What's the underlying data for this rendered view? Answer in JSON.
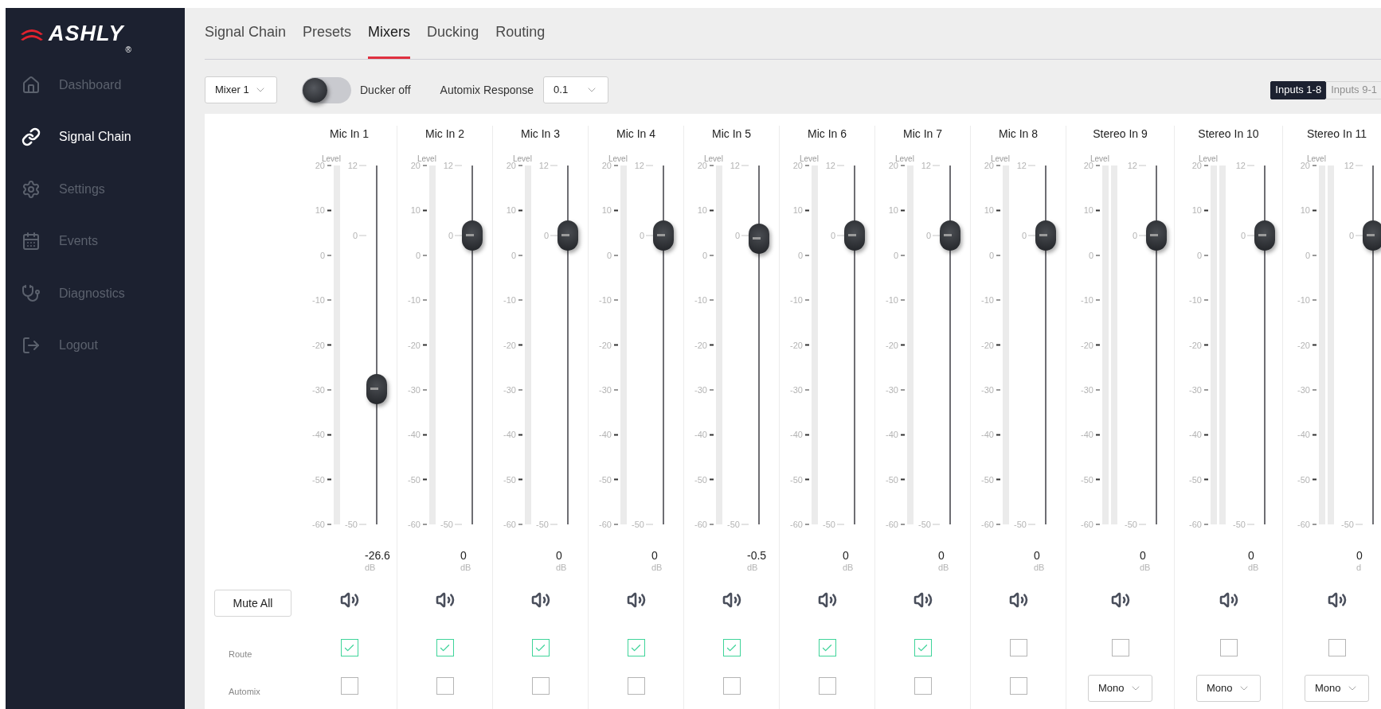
{
  "logo": {
    "text": "ASHLY",
    "mark": "®"
  },
  "sidebar": {
    "items": [
      {
        "label": "Dashboard",
        "selected": false
      },
      {
        "label": "Signal Chain",
        "selected": true
      },
      {
        "label": "Settings",
        "selected": false
      },
      {
        "label": "Events",
        "selected": false
      },
      {
        "label": "Diagnostics",
        "selected": false
      },
      {
        "label": "Logout",
        "selected": false
      }
    ]
  },
  "tabs": [
    {
      "label": "Signal Chain",
      "selected": false
    },
    {
      "label": "Presets",
      "selected": false
    },
    {
      "label": "Mixers",
      "selected": true
    },
    {
      "label": "Ducking",
      "selected": false
    },
    {
      "label": "Routing",
      "selected": false
    }
  ],
  "toolbar": {
    "mixer": "Mixer 1",
    "ducker": {
      "on": false,
      "label": "Ducker off"
    },
    "automix_label": "Automix Response",
    "automix_value": "0.1",
    "inputs": [
      {
        "label": "Inputs 1-8",
        "selected": true
      },
      {
        "label": "Inputs 9-1",
        "selected": false
      }
    ]
  },
  "panel": {
    "mute_all": "Mute All",
    "route_label": "Route",
    "automix_label": "Automix",
    "channels": [
      {
        "name": "Mic In 1",
        "kind": "mic",
        "meter_label": "Level",
        "meter_ticks": [
          "20",
          "10",
          "0",
          "-10",
          "-20",
          "-30",
          "-40",
          "-50",
          "-60"
        ],
        "fader_ticks": [
          "12",
          "0",
          "-50"
        ],
        "level": 0.377,
        "value": "-26.6",
        "unit": "dB",
        "muted": false,
        "route": true,
        "automix": false
      },
      {
        "name": "Mic In 2",
        "kind": "mic",
        "meter_label": "Level",
        "meter_ticks": [
          "20",
          "10",
          "0",
          "-10",
          "-20",
          "-30",
          "-40",
          "-50",
          "-60"
        ],
        "fader_ticks": [
          "12",
          "0",
          "-50"
        ],
        "level": 0.805,
        "value": "0",
        "unit": "dB",
        "muted": false,
        "route": true,
        "automix": false
      },
      {
        "name": "Mic In 3",
        "kind": "mic",
        "meter_label": "Level",
        "meter_ticks": [
          "20",
          "10",
          "0",
          "-10",
          "-20",
          "-30",
          "-40",
          "-50",
          "-60"
        ],
        "fader_ticks": [
          "12",
          "0",
          "-50"
        ],
        "level": 0.805,
        "value": "0",
        "unit": "dB",
        "muted": false,
        "route": true,
        "automix": false
      },
      {
        "name": "Mic In 4",
        "kind": "mic",
        "meter_label": "Level",
        "meter_ticks": [
          "20",
          "10",
          "0",
          "-10",
          "-20",
          "-30",
          "-40",
          "-50",
          "-60"
        ],
        "fader_ticks": [
          "12",
          "0",
          "-50"
        ],
        "level": 0.805,
        "value": "0",
        "unit": "dB",
        "muted": false,
        "route": true,
        "automix": false
      },
      {
        "name": "Mic In 5",
        "kind": "mic",
        "meter_label": "Level",
        "meter_ticks": [
          "20",
          "10",
          "0",
          "-10",
          "-20",
          "-30",
          "-40",
          "-50",
          "-60"
        ],
        "fader_ticks": [
          "12",
          "0",
          "-50"
        ],
        "level": 0.797,
        "value": "-0.5",
        "unit": "dB",
        "muted": false,
        "route": true,
        "automix": false
      },
      {
        "name": "Mic In 6",
        "kind": "mic",
        "meter_label": "Level",
        "meter_ticks": [
          "20",
          "10",
          "0",
          "-10",
          "-20",
          "-30",
          "-40",
          "-50",
          "-60"
        ],
        "fader_ticks": [
          "12",
          "0",
          "-50"
        ],
        "level": 0.805,
        "value": "0",
        "unit": "dB",
        "muted": false,
        "route": true,
        "automix": false
      },
      {
        "name": "Mic In 7",
        "kind": "mic",
        "meter_label": "Level",
        "meter_ticks": [
          "20",
          "10",
          "0",
          "-10",
          "-20",
          "-30",
          "-40",
          "-50",
          "-60"
        ],
        "fader_ticks": [
          "12",
          "0",
          "-50"
        ],
        "level": 0.805,
        "value": "0",
        "unit": "dB",
        "muted": false,
        "route": true,
        "automix": false
      },
      {
        "name": "Mic In 8",
        "kind": "mic",
        "meter_label": "Level",
        "meter_ticks": [
          "20",
          "10",
          "0",
          "-10",
          "-20",
          "-30",
          "-40",
          "-50",
          "-60"
        ],
        "fader_ticks": [
          "12",
          "0",
          "-50"
        ],
        "level": 0.805,
        "value": "0",
        "unit": "dB",
        "muted": false,
        "route": false,
        "automix": false
      },
      {
        "name": "Stereo In 9",
        "kind": "stereo",
        "meter_label": "Level",
        "meter_ticks": [
          "20",
          "10",
          "0",
          "-10",
          "-20",
          "-30",
          "-40",
          "-50",
          "-60"
        ],
        "fader_ticks": [
          "12",
          "0",
          "-50"
        ],
        "level": 0.805,
        "value": "0",
        "unit": "dB",
        "muted": false,
        "route": false,
        "mode": "Mono"
      },
      {
        "name": "Stereo In 10",
        "kind": "stereo",
        "meter_label": "Level",
        "meter_ticks": [
          "20",
          "10",
          "0",
          "-10",
          "-20",
          "-30",
          "-40",
          "-50",
          "-60"
        ],
        "fader_ticks": [
          "12",
          "0",
          "-50"
        ],
        "level": 0.805,
        "value": "0",
        "unit": "dB",
        "muted": false,
        "route": false,
        "mode": "Mono"
      },
      {
        "name": "Stereo In 11",
        "kind": "stereo",
        "meter_label": "Level",
        "meter_ticks": [
          "20",
          "10",
          "0",
          "-10",
          "-20",
          "-30",
          "-40",
          "-50",
          "-60"
        ],
        "fader_ticks": [
          "12",
          "0",
          "-50"
        ],
        "level": 0.805,
        "value": "0",
        "unit": "d",
        "muted": false,
        "route": false,
        "mode": "Mono"
      }
    ]
  }
}
